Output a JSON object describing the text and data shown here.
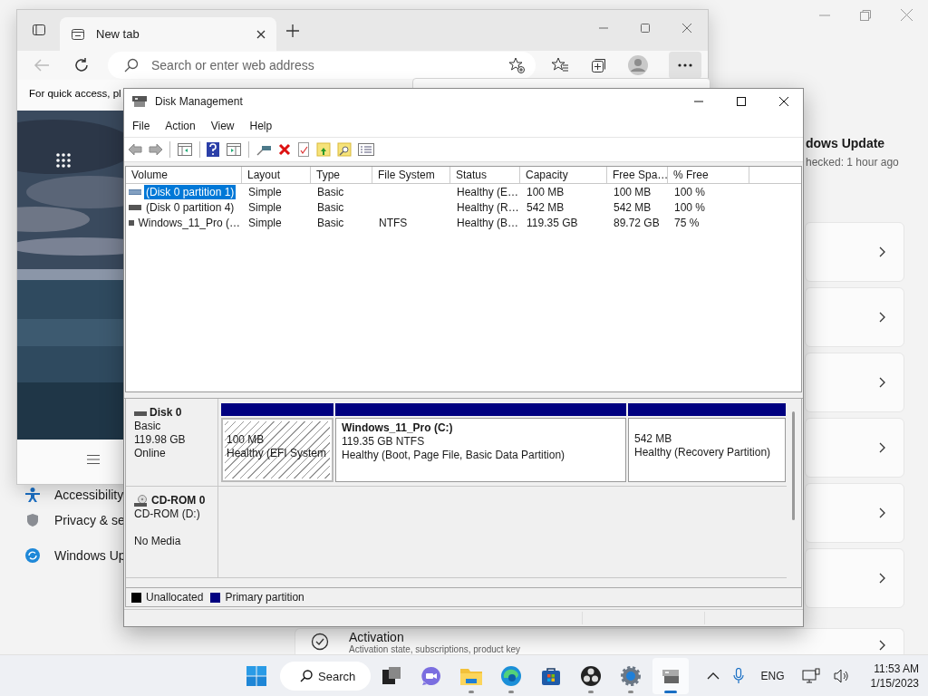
{
  "settings": {
    "heading": "dows Update",
    "subheading": "hecked: 1 hour ago",
    "nav": [
      {
        "kind": "accessibility",
        "label": "Accessibility"
      },
      {
        "kind": "privacy",
        "label": "Privacy & se"
      },
      {
        "kind": "update",
        "label": "Windows Up"
      }
    ],
    "activation": {
      "title": "Activation",
      "subtitle": "Activation state, subscriptions, product key"
    }
  },
  "browser": {
    "tab": "New tab",
    "address_placeholder": "Search or enter web address",
    "quick_access": "For quick access, pl"
  },
  "disk_management": {
    "title": "Disk Management",
    "menu": [
      "File",
      "Action",
      "View",
      "Help"
    ],
    "columns": [
      "Volume",
      "Layout",
      "Type",
      "File System",
      "Status",
      "Capacity",
      "Free Spa…",
      "% Free"
    ],
    "rows": [
      {
        "volume": "(Disk 0 partition 1)",
        "selected": true,
        "layout": "Simple",
        "type": "Basic",
        "file_system": "",
        "status": "Healthy (E…",
        "capacity": "100 MB",
        "free_space": "100 MB",
        "percent_free": "100 %"
      },
      {
        "volume": "(Disk 0 partition 4)",
        "selected": false,
        "layout": "Simple",
        "type": "Basic",
        "file_system": "",
        "status": "Healthy (R…",
        "capacity": "542 MB",
        "free_space": "542 MB",
        "percent_free": "100 %"
      },
      {
        "volume": "Windows_11_Pro (…",
        "selected": false,
        "layout": "Simple",
        "type": "Basic",
        "file_system": "NTFS",
        "status": "Healthy (B…",
        "capacity": "119.35 GB",
        "free_space": "89.72 GB",
        "percent_free": "75 %"
      }
    ],
    "disks": [
      {
        "kind": "disk",
        "name": "Disk 0",
        "type": "Basic",
        "size": "119.98 GB",
        "status": "Online",
        "partitions": [
          {
            "size": "100 MB",
            "status": "Healthy (EFI System",
            "selected": true
          },
          {
            "title": "Windows_11_Pro (C:)",
            "size": "119.35 GB NTFS",
            "status": "Healthy (Boot, Page File, Basic Data Partition)",
            "selected": false
          },
          {
            "size": "542 MB",
            "status": "Healthy (Recovery Partition)",
            "selected": false
          }
        ]
      },
      {
        "kind": "cdrom",
        "name": "CD-ROM 0",
        "type": "CD-ROM (D:)",
        "status": "No Media"
      }
    ],
    "legend": [
      {
        "label": "Unallocated",
        "color": "#000000"
      },
      {
        "label": "Primary partition",
        "color": "#000080"
      }
    ]
  },
  "taskbar": {
    "search_label": "Search",
    "apps": [
      {
        "kind": "task-view",
        "running": false,
        "selected": false
      },
      {
        "kind": "chat",
        "running": false,
        "selected": false
      },
      {
        "kind": "folder",
        "running": true,
        "selected": false
      },
      {
        "kind": "browser",
        "running": true,
        "selected": false
      },
      {
        "kind": "store",
        "running": false,
        "selected": false
      },
      {
        "kind": "recorder",
        "running": true,
        "selected": false
      },
      {
        "kind": "settings",
        "running": true,
        "selected": false
      },
      {
        "kind": "disk",
        "running": true,
        "selected": true
      }
    ],
    "language": "ENG",
    "time": "11:53 AM",
    "date": "1/15/2023"
  }
}
